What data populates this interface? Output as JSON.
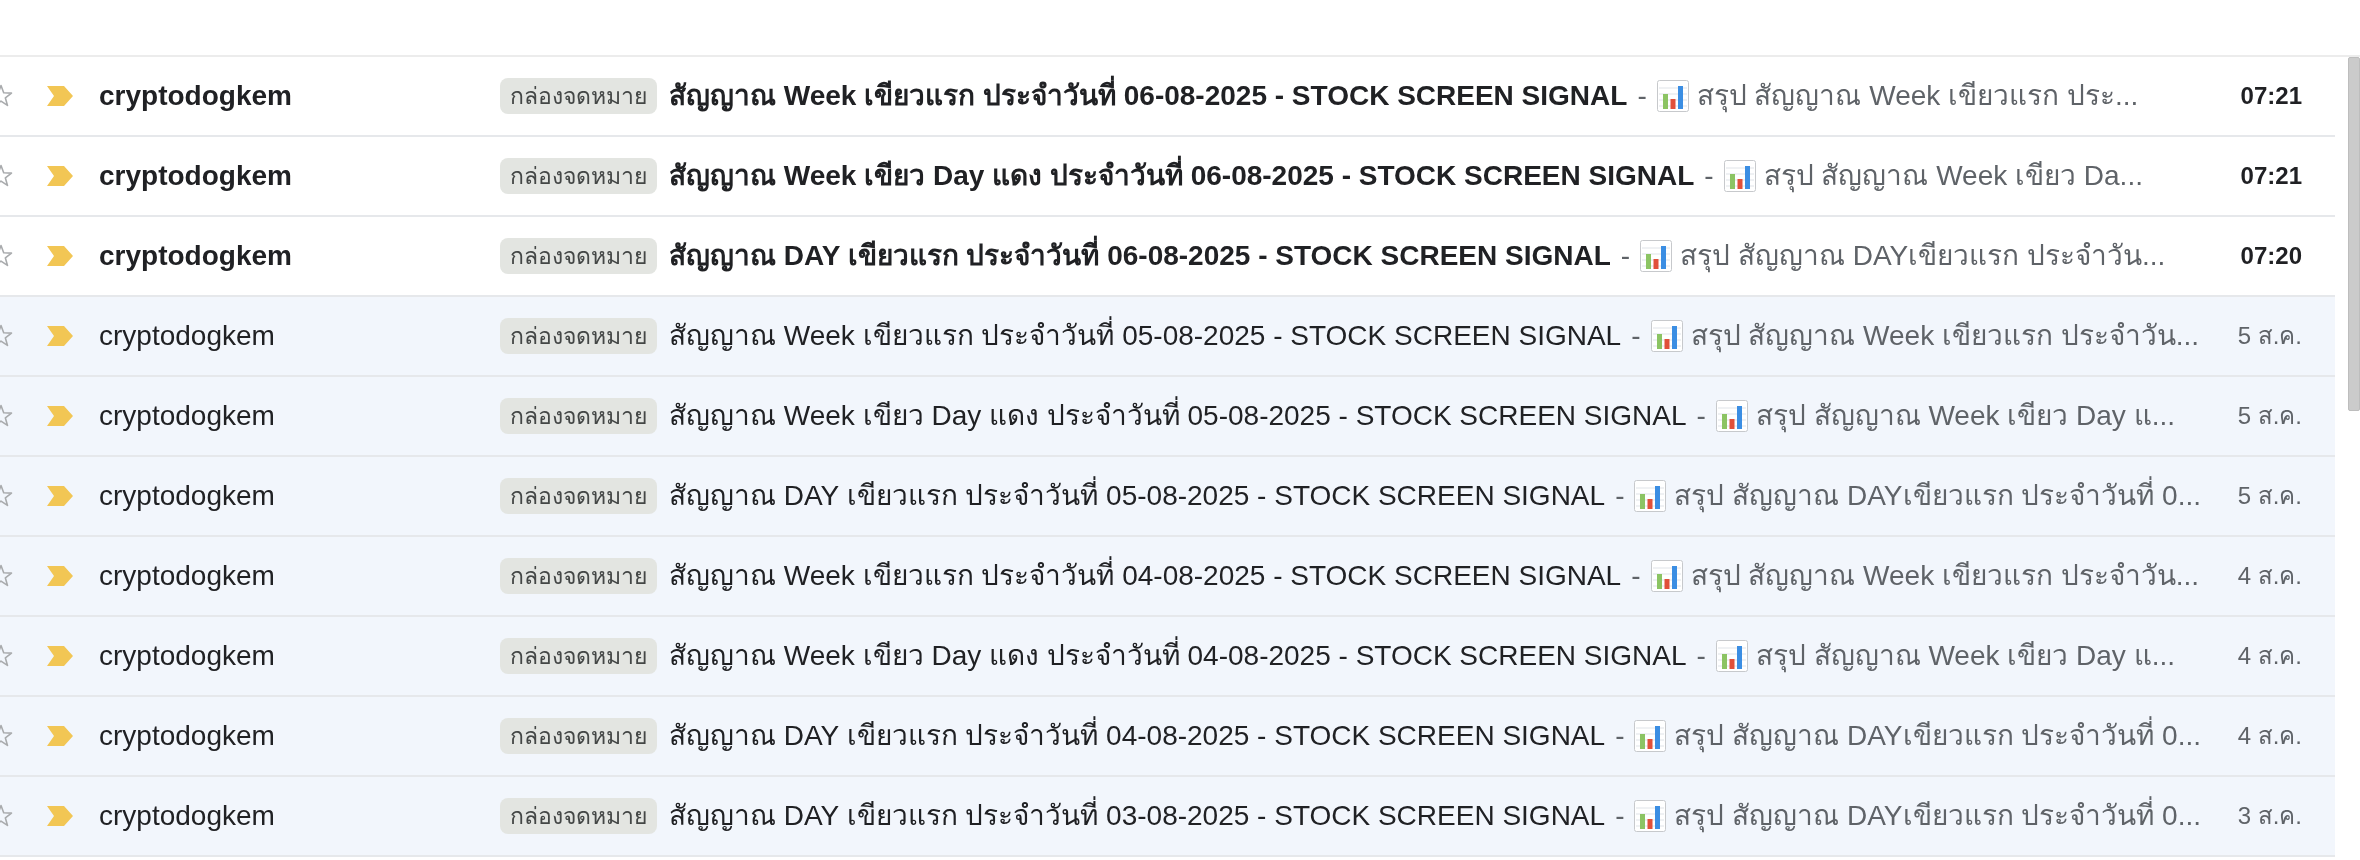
{
  "rows": [
    {
      "starred": false,
      "important": true,
      "unread": true,
      "sender": "cryptodogkem",
      "label": "กล่องจดหมาย",
      "subject": "สัญญาณ Week เขียวแรก ประจำวันที่ 06-08-2025 - STOCK SCREEN SIGNAL",
      "separator": "-",
      "snippet": "สรุป สัญญาณ Week เขียวแรก ประ...",
      "time": "07:21"
    },
    {
      "starred": false,
      "important": true,
      "unread": true,
      "sender": "cryptodogkem",
      "label": "กล่องจดหมาย",
      "subject": "สัญญาณ Week เขียว Day แดง ประจำวันที่ 06-08-2025 - STOCK SCREEN SIGNAL",
      "separator": "-",
      "snippet": "สรุป สัญญาณ Week เขียว Da...",
      "time": "07:21"
    },
    {
      "starred": false,
      "important": true,
      "unread": true,
      "sender": "cryptodogkem",
      "label": "กล่องจดหมาย",
      "subject": "สัญญาณ DAY เขียวแรก ประจำวันที่ 06-08-2025 - STOCK SCREEN SIGNAL",
      "separator": "-",
      "snippet": "สรุป สัญญาณ DAYเขียวแรก ประจำวัน...",
      "time": "07:20"
    },
    {
      "starred": false,
      "important": true,
      "unread": false,
      "sender": "cryptodogkem",
      "label": "กล่องจดหมาย",
      "subject": "สัญญาณ Week เขียวแรก ประจำวันที่ 05-08-2025 - STOCK SCREEN SIGNAL",
      "separator": "-",
      "snippet": "สรุป สัญญาณ Week เขียวแรก ประจำวัน...",
      "time": "5 ส.ค."
    },
    {
      "starred": false,
      "important": true,
      "unread": false,
      "sender": "cryptodogkem",
      "label": "กล่องจดหมาย",
      "subject": "สัญญาณ Week เขียว Day แดง ประจำวันที่ 05-08-2025 - STOCK SCREEN SIGNAL",
      "separator": "-",
      "snippet": "สรุป สัญญาณ Week เขียว Day แ...",
      "time": "5 ส.ค."
    },
    {
      "starred": false,
      "important": true,
      "unread": false,
      "sender": "cryptodogkem",
      "label": "กล่องจดหมาย",
      "subject": "สัญญาณ DAY เขียวแรก ประจำวันที่ 05-08-2025 - STOCK SCREEN SIGNAL",
      "separator": "-",
      "snippet": "สรุป สัญญาณ DAYเขียวแรก ประจำวันที่ 0...",
      "time": "5 ส.ค."
    },
    {
      "starred": false,
      "important": true,
      "unread": false,
      "sender": "cryptodogkem",
      "label": "กล่องจดหมาย",
      "subject": "สัญญาณ Week เขียวแรก ประจำวันที่ 04-08-2025 - STOCK SCREEN SIGNAL",
      "separator": "-",
      "snippet": "สรุป สัญญาณ Week เขียวแรก ประจำวัน...",
      "time": "4 ส.ค."
    },
    {
      "starred": false,
      "important": true,
      "unread": false,
      "sender": "cryptodogkem",
      "label": "กล่องจดหมาย",
      "subject": "สัญญาณ Week เขียว Day แดง ประจำวันที่ 04-08-2025 - STOCK SCREEN SIGNAL",
      "separator": "-",
      "snippet": "สรุป สัญญาณ Week เขียว Day แ...",
      "time": "4 ส.ค."
    },
    {
      "starred": false,
      "important": true,
      "unread": false,
      "sender": "cryptodogkem",
      "label": "กล่องจดหมาย",
      "subject": "สัญญาณ DAY เขียวแรก ประจำวันที่ 04-08-2025 - STOCK SCREEN SIGNAL",
      "separator": "-",
      "snippet": "สรุป สัญญาณ DAYเขียวแรก ประจำวันที่ 0...",
      "time": "4 ส.ค."
    },
    {
      "starred": false,
      "important": true,
      "unread": false,
      "sender": "cryptodogkem",
      "label": "กล่องจดหมาย",
      "subject": "สัญญาณ DAY เขียวแรก ประจำวันที่ 03-08-2025 - STOCK SCREEN SIGNAL",
      "separator": "-",
      "snippet": "สรุป สัญญาณ DAYเขียวแรก ประจำวันที่ 0...",
      "time": "3 ส.ค."
    }
  ]
}
